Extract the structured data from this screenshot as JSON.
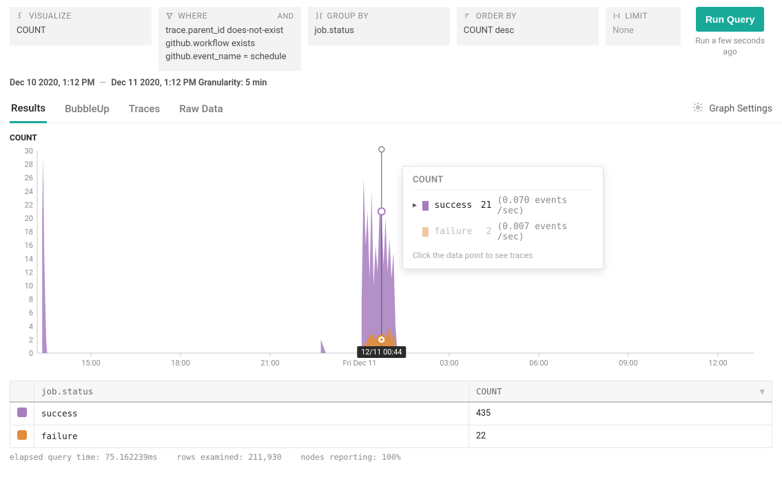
{
  "query_builder": {
    "visualize": {
      "label": "VISUALIZE",
      "value": "COUNT"
    },
    "where": {
      "label": "WHERE",
      "join": "AND",
      "clauses": [
        "trace.parent_id does-not-exist",
        "github.workflow exists",
        "github.event_name = schedule"
      ]
    },
    "group_by": {
      "label": "GROUP BY",
      "value": "job.status"
    },
    "order_by": {
      "label": "ORDER BY",
      "value": "COUNT desc"
    },
    "limit": {
      "label": "LIMIT",
      "value": "None"
    }
  },
  "run_button": "Run Query",
  "run_time": "Run a few seconds ago",
  "time_range": {
    "from": "Dec 10 2020, 1:12 PM",
    "to": "Dec 11 2020, 1:12 PM",
    "granularity_label": "Granularity:",
    "granularity": "5 min"
  },
  "tabs": [
    "Results",
    "BubbleUp",
    "Traces",
    "Raw Data"
  ],
  "active_tab_index": 0,
  "graph_settings_label": "Graph Settings",
  "chart": {
    "title": "COUNT",
    "ylim": [
      0,
      30
    ],
    "y_ticks": [
      0,
      2,
      4,
      6,
      8,
      10,
      12,
      14,
      16,
      18,
      20,
      22,
      24,
      26,
      28,
      30
    ],
    "x_ticks": [
      "15:00",
      "18:00",
      "21:00",
      "Fri Dec 11",
      "03:00",
      "06:00",
      "09:00",
      "12:00"
    ],
    "highlight_time": "12/11 00:44"
  },
  "tooltip": {
    "title": "COUNT",
    "rows": [
      {
        "name": "success",
        "value": 21,
        "rate": "(0.070 events /sec)",
        "color": "#a77cbf",
        "active": true
      },
      {
        "name": "failure",
        "value": 2,
        "rate": "(0.007 events /sec)",
        "color": "#df8e3c",
        "active": false
      }
    ],
    "footer": "Click the data point to see traces"
  },
  "results_table": {
    "headers": [
      "job.status",
      "COUNT"
    ],
    "rows": [
      {
        "swatch": "#a77cbf",
        "job.status": "success",
        "COUNT": 435
      },
      {
        "swatch": "#df8e3c",
        "job.status": "failure",
        "COUNT": 22
      }
    ]
  },
  "footer_stats": {
    "elapsed": "elapsed query time: 75.162239ms",
    "rows": "rows examined: 211,930",
    "nodes": "nodes reporting: 100%"
  },
  "chart_data": {
    "type": "area",
    "title": "COUNT",
    "xlabel": "",
    "ylabel": "",
    "ylim": [
      0,
      30
    ],
    "x_unit": "minutes since Dec 10 2020 13:12",
    "series": [
      {
        "name": "success",
        "color": "#a77cbf",
        "points": [
          [
            10,
            20
          ],
          [
            12,
            29
          ],
          [
            14,
            15
          ],
          [
            16,
            8
          ],
          [
            18,
            2
          ],
          [
            20,
            0
          ],
          [
            570,
            2
          ],
          [
            575,
            1
          ],
          [
            580,
            0
          ],
          [
            652,
            8
          ],
          [
            656,
            26
          ],
          [
            660,
            16
          ],
          [
            664,
            21
          ],
          [
            668,
            11
          ],
          [
            672,
            24
          ],
          [
            676,
            10
          ],
          [
            680,
            16
          ],
          [
            684,
            12
          ],
          [
            688,
            21
          ],
          [
            692,
            21
          ],
          [
            696,
            13
          ],
          [
            700,
            20
          ],
          [
            704,
            12
          ],
          [
            708,
            17
          ],
          [
            712,
            11
          ],
          [
            716,
            15
          ],
          [
            720,
            4
          ],
          [
            724,
            0
          ]
        ]
      },
      {
        "name": "failure",
        "color": "#df8e3c",
        "points": [
          [
            656,
            1
          ],
          [
            664,
            2
          ],
          [
            672,
            3
          ],
          [
            680,
            2
          ],
          [
            688,
            2
          ],
          [
            692,
            2
          ],
          [
            696,
            3
          ],
          [
            700,
            2
          ],
          [
            708,
            4
          ],
          [
            712,
            2
          ],
          [
            716,
            3
          ],
          [
            720,
            1
          ],
          [
            724,
            0
          ]
        ]
      }
    ],
    "hover_x": 692
  }
}
